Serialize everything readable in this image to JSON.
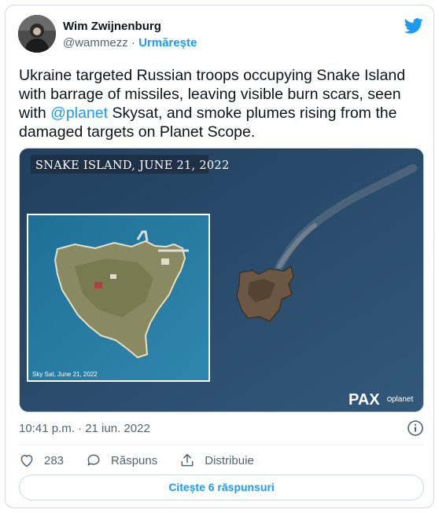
{
  "author": {
    "name": "Wim Zwijnenburg",
    "handle": "@wammezz",
    "separator": "·",
    "follow_label": "Urmărește"
  },
  "tweet": {
    "text_before": "Ukraine targeted Russian troops occupying Snake Island with barrage of missiles, leaving visible burn scars, seen with ",
    "mention": "@planet",
    "text_after": " Skysat, and smoke plumes rising from the damaged targets on Planet Scope."
  },
  "media": {
    "caption_banner": "SNAKE ISLAND, JUNE 21, 2022",
    "inset_caption": "Sky Sat, June 21, 2022",
    "logo_pax": "PAX",
    "logo_planet": "planet"
  },
  "meta": {
    "timestamp": "10:41 p.m. · 21 iun. 2022"
  },
  "actions": {
    "likes_count": "283",
    "reply_label": "Răspuns",
    "share_label": "Distribuie"
  },
  "replies_button": "Citește 6 răspunsuri",
  "colors": {
    "accent": "#1d9bf0",
    "secondary_text": "#536471",
    "border": "#cfd9de"
  },
  "icons": [
    "twitter-bird-icon",
    "info-icon",
    "heart-icon",
    "reply-icon",
    "share-icon"
  ]
}
